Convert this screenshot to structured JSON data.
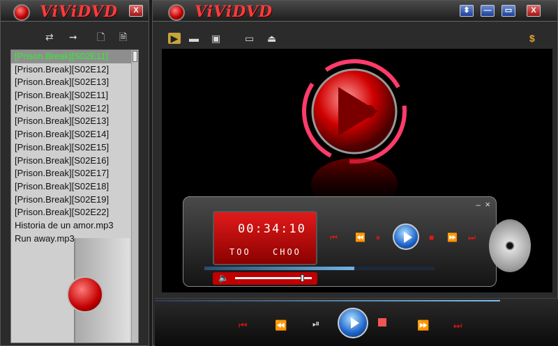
{
  "playlist_window": {
    "logo_text": "ViViDVD",
    "close_label": "X"
  },
  "main_window": {
    "logo_text": "ViViDVD",
    "buttons": [
      "⬍",
      "—",
      "▭",
      "X"
    ]
  },
  "playlist": {
    "items": [
      "[Prison.Break][S02E11]",
      "[Prison.Break][S02E12]",
      "[Prison.Break][S02E13]",
      "[Prison.Break][S02E11]",
      "[Prison.Break][S02E12]",
      "[Prison.Break][S02E13]",
      "[Prison.Break][S02E14]",
      "[Prison.Break][S02E15]",
      "[Prison.Break][S02E16]",
      "[Prison.Break][S02E17]",
      "[Prison.Break][S02E18]",
      "[Prison.Break][S02E19]",
      "[Prison.Break][S02E22]",
      "Historia de un amor.mp3",
      "Run away.mp3"
    ],
    "active_index": 0
  },
  "mini_player": {
    "time": "00:34:10",
    "line_left": "TOO",
    "line_right": "CHOO",
    "min_label": "–",
    "close_label": "×",
    "progress": 0.65,
    "volume": 0.85
  },
  "colors": {
    "accent": "#e01818",
    "active_item": "#2ff02f",
    "playlist_bg": "#cfcfcf"
  },
  "icons": [
    "repeat-icon",
    "arrow-right-icon",
    "file-add-icon",
    "file-icon",
    "open-file-icon",
    "camera-icon",
    "record-icon",
    "folder-icon",
    "eject-icon",
    "dollar-icon"
  ]
}
